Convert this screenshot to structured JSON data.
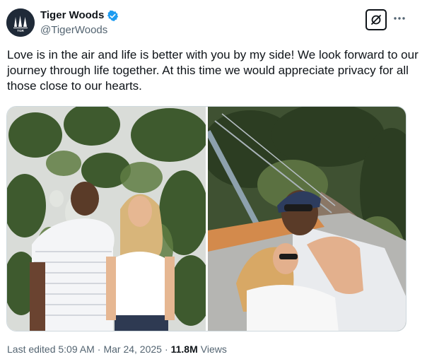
{
  "author": {
    "display_name": "Tiger Woods",
    "handle": "@TigerWoods",
    "avatar_text": "TGR",
    "verified": true,
    "verified_color": "#1d9bf0"
  },
  "actions": {
    "grok_icon": "grok-icon",
    "more_icon": "more-horizontal-icon"
  },
  "tweet": {
    "text": "Love is in the air and life is better with you by my side! We look forward to our journey through life together. At this time we would appreciate privacy for all those close to our hearts."
  },
  "media": [
    {
      "kind": "photo",
      "description_icon": "photo-couple-standing"
    },
    {
      "kind": "photo",
      "description_icon": "photo-couple-hammock"
    }
  ],
  "meta": {
    "edited_label": "Last edited 5:09 AM",
    "separator": "·",
    "date": "Mar 24, 2025",
    "views_count": "11.8M",
    "views_label": "Views"
  },
  "colors": {
    "text_primary": "#0f1419",
    "text_secondary": "#536471",
    "border": "#cfd9de",
    "accent": "#1d9bf0"
  }
}
